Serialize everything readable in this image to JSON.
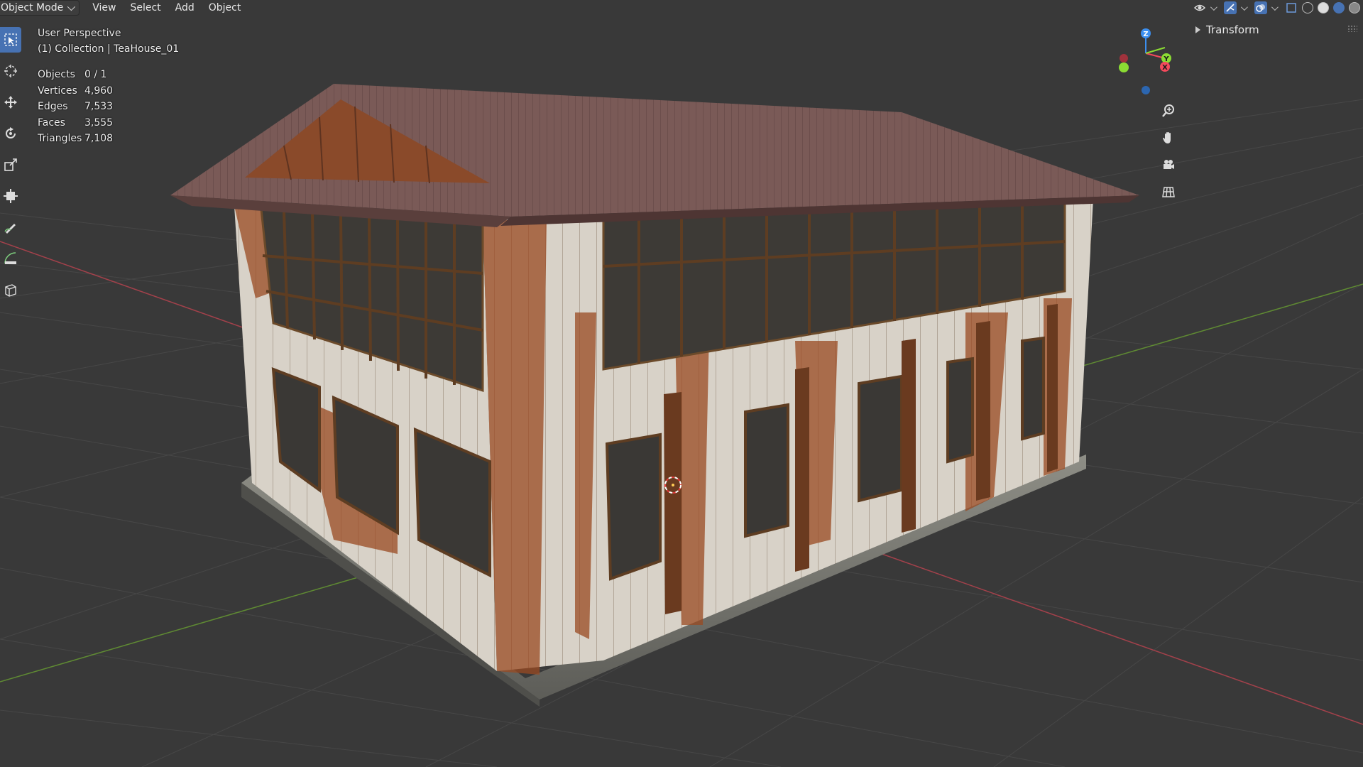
{
  "header": {
    "mode": "Object Mode",
    "menu": [
      "View",
      "Select",
      "Add",
      "Object"
    ]
  },
  "viewport": {
    "view_name": "User Perspective",
    "collection_line": "(1) Collection | TeaHouse_01",
    "stats": [
      {
        "label": "Objects",
        "value": "0 / 1"
      },
      {
        "label": "Vertices",
        "value": "4,960"
      },
      {
        "label": "Edges",
        "value": "7,533"
      },
      {
        "label": "Faces",
        "value": "3,555"
      },
      {
        "label": "Triangles",
        "value": "7,108"
      }
    ]
  },
  "gizmo": {
    "x": "X",
    "y": "Y",
    "z": "Z"
  },
  "sidebar": {
    "panel_title": "Transform"
  },
  "colors": {
    "background": "#393939",
    "grid": "#4a4a4a",
    "x_axis": "#b3404c",
    "y_axis": "#6a9a35",
    "active_tool": "#4772b3",
    "gizmo_x": "#f54a5c",
    "gizmo_y": "#8bdc33",
    "gizmo_z": "#3c8ff0"
  },
  "icons": [
    "select-box-icon",
    "cursor-icon",
    "move-icon",
    "rotate-icon",
    "scale-icon",
    "transform-icon",
    "annotate-icon",
    "measure-icon",
    "add-cube-icon",
    "zoom-icon",
    "hand-pan-icon",
    "camera-icon",
    "grid-ortho-icon"
  ]
}
